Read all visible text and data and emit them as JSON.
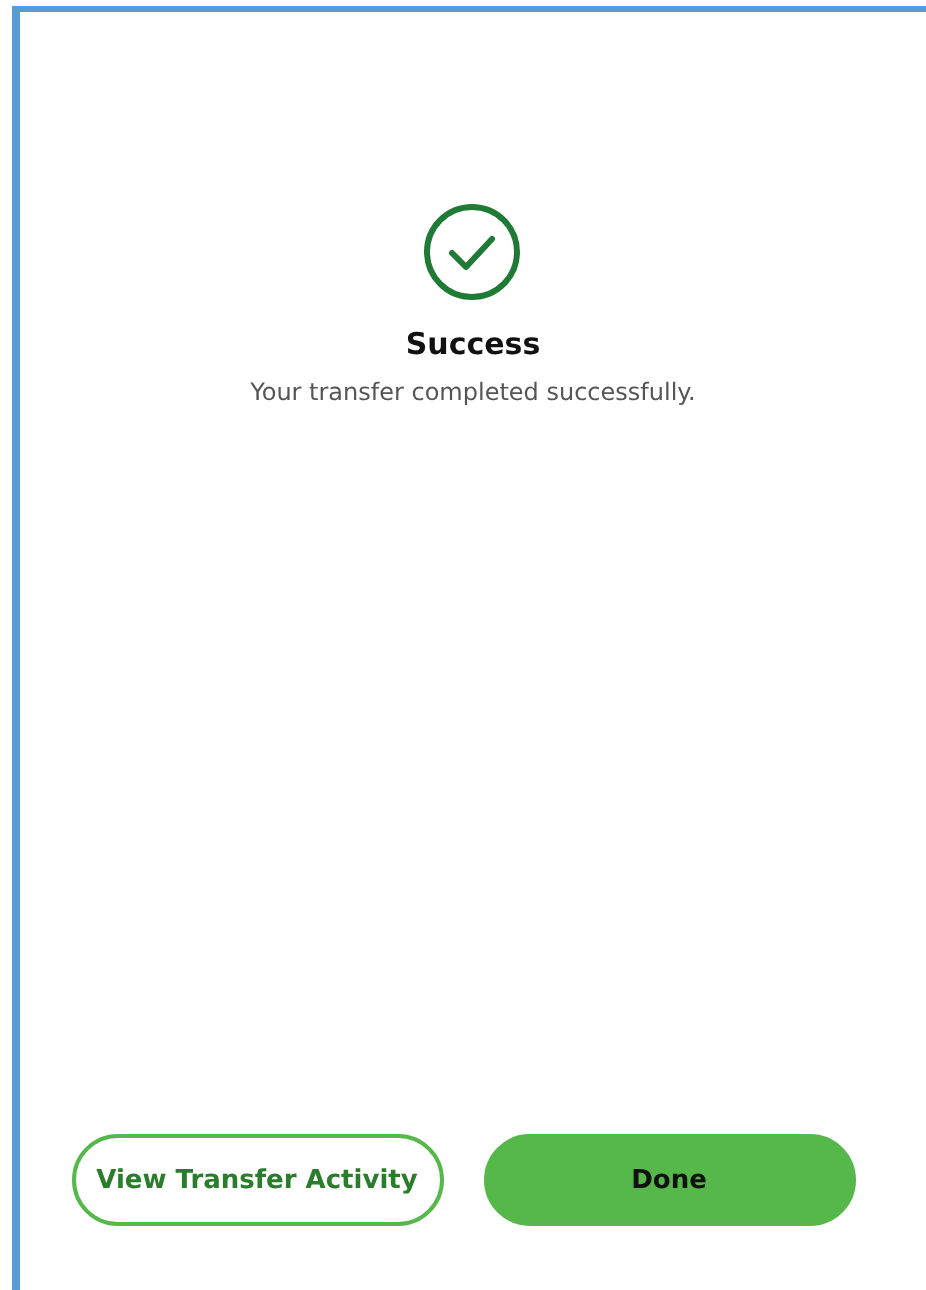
{
  "title": "Success",
  "message": "Your transfer completed successfully.",
  "buttons": [
    {
      "label": "View Transfer Activity",
      "kind": "outline"
    },
    {
      "label": "Done",
      "kind": "filled"
    }
  ]
}
